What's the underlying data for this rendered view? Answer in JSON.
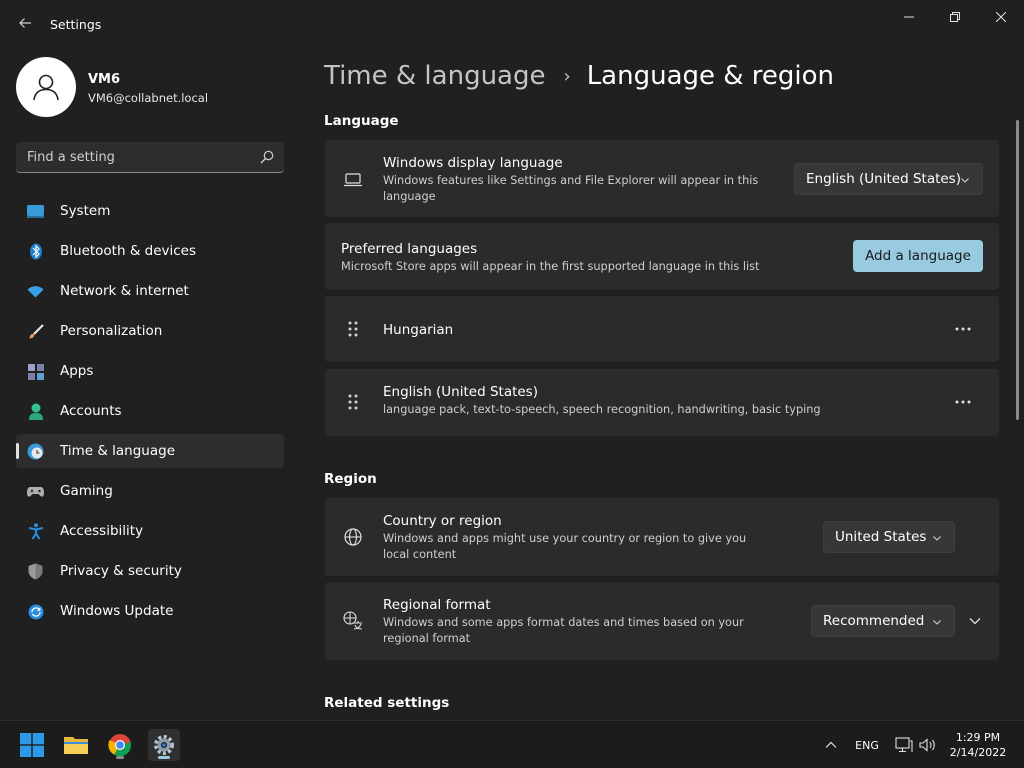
{
  "window": {
    "title": "Settings",
    "back_icon": "back-arrow-icon",
    "minimize_icon": "minimize-icon",
    "maximize_icon": "restore-icon",
    "close_icon": "close-icon"
  },
  "user": {
    "name": "VM6",
    "email": "VM6@collabnet.local",
    "avatar_icon": "person-icon"
  },
  "search": {
    "placeholder": "Find a setting",
    "value": "",
    "icon": "search-icon"
  },
  "sidebar": {
    "items": [
      {
        "label": "System",
        "icon": "system-monitor-icon",
        "color": "#3a9ad9"
      },
      {
        "label": "Bluetooth & devices",
        "icon": "bluetooth-icon",
        "color": "#1d7fd1"
      },
      {
        "label": "Network & internet",
        "icon": "wifi-icon",
        "color": "#3aa0e6"
      },
      {
        "label": "Personalization",
        "icon": "brush-icon",
        "color": "#e89a5c"
      },
      {
        "label": "Apps",
        "icon": "apps-icon",
        "color": "#8a8fb8"
      },
      {
        "label": "Accounts",
        "icon": "accounts-icon",
        "color": "#34c097"
      },
      {
        "label": "Time & language",
        "icon": "clock-globe-icon",
        "color": "#3a9ad9"
      },
      {
        "label": "Gaming",
        "icon": "gamepad-icon",
        "color": "#b0b0b0"
      },
      {
        "label": "Accessibility",
        "icon": "accessibility-icon",
        "color": "#2b8de0"
      },
      {
        "label": "Privacy & security",
        "icon": "shield-icon",
        "color": "#9a9a9a"
      },
      {
        "label": "Windows Update",
        "icon": "update-icon",
        "color": "#2b8de0"
      }
    ],
    "selected_index": 6
  },
  "breadcrumb": {
    "parent": "Time & language",
    "separator": "›",
    "current": "Language & region"
  },
  "language": {
    "section_title": "Language",
    "display_language": {
      "title": "Windows display language",
      "description": "Windows features like Settings and File Explorer will appear in this language",
      "value": "English (United States)",
      "icon": "laptop-icon"
    },
    "preferred": {
      "title": "Preferred languages",
      "description": "Microsoft Store apps will appear in the first supported language in this list",
      "button_label": "Add a language"
    },
    "languages": [
      {
        "name": "Hungarian",
        "details": ""
      },
      {
        "name": "English (United States)",
        "details": "language pack, text-to-speech, speech recognition, handwriting, basic typing"
      }
    ]
  },
  "region": {
    "section_title": "Region",
    "country": {
      "title": "Country or region",
      "description": "Windows and apps might use your country or region to give you local content",
      "value": "United States",
      "icon": "globe-icon"
    },
    "format": {
      "title": "Regional format",
      "description": "Windows and some apps format dates and times based on your regional format",
      "value": "Recommended",
      "icon": "regional-format-icon"
    }
  },
  "related": {
    "section_title": "Related settings"
  },
  "taskbar": {
    "apps": [
      {
        "name": "Start",
        "icon": "windows-start-icon"
      },
      {
        "name": "File Explorer",
        "icon": "folder-icon"
      },
      {
        "name": "Google Chrome",
        "icon": "chrome-icon"
      },
      {
        "name": "Settings",
        "icon": "settings-gear-icon"
      }
    ],
    "tray": {
      "language": "ENG",
      "time": "1:29 PM",
      "date": "2/14/2022"
    }
  },
  "colors": {
    "background": "#202020",
    "card": "#2b2b2b",
    "accent": "#99cbe0",
    "taskbar": "#1c1c1c"
  }
}
